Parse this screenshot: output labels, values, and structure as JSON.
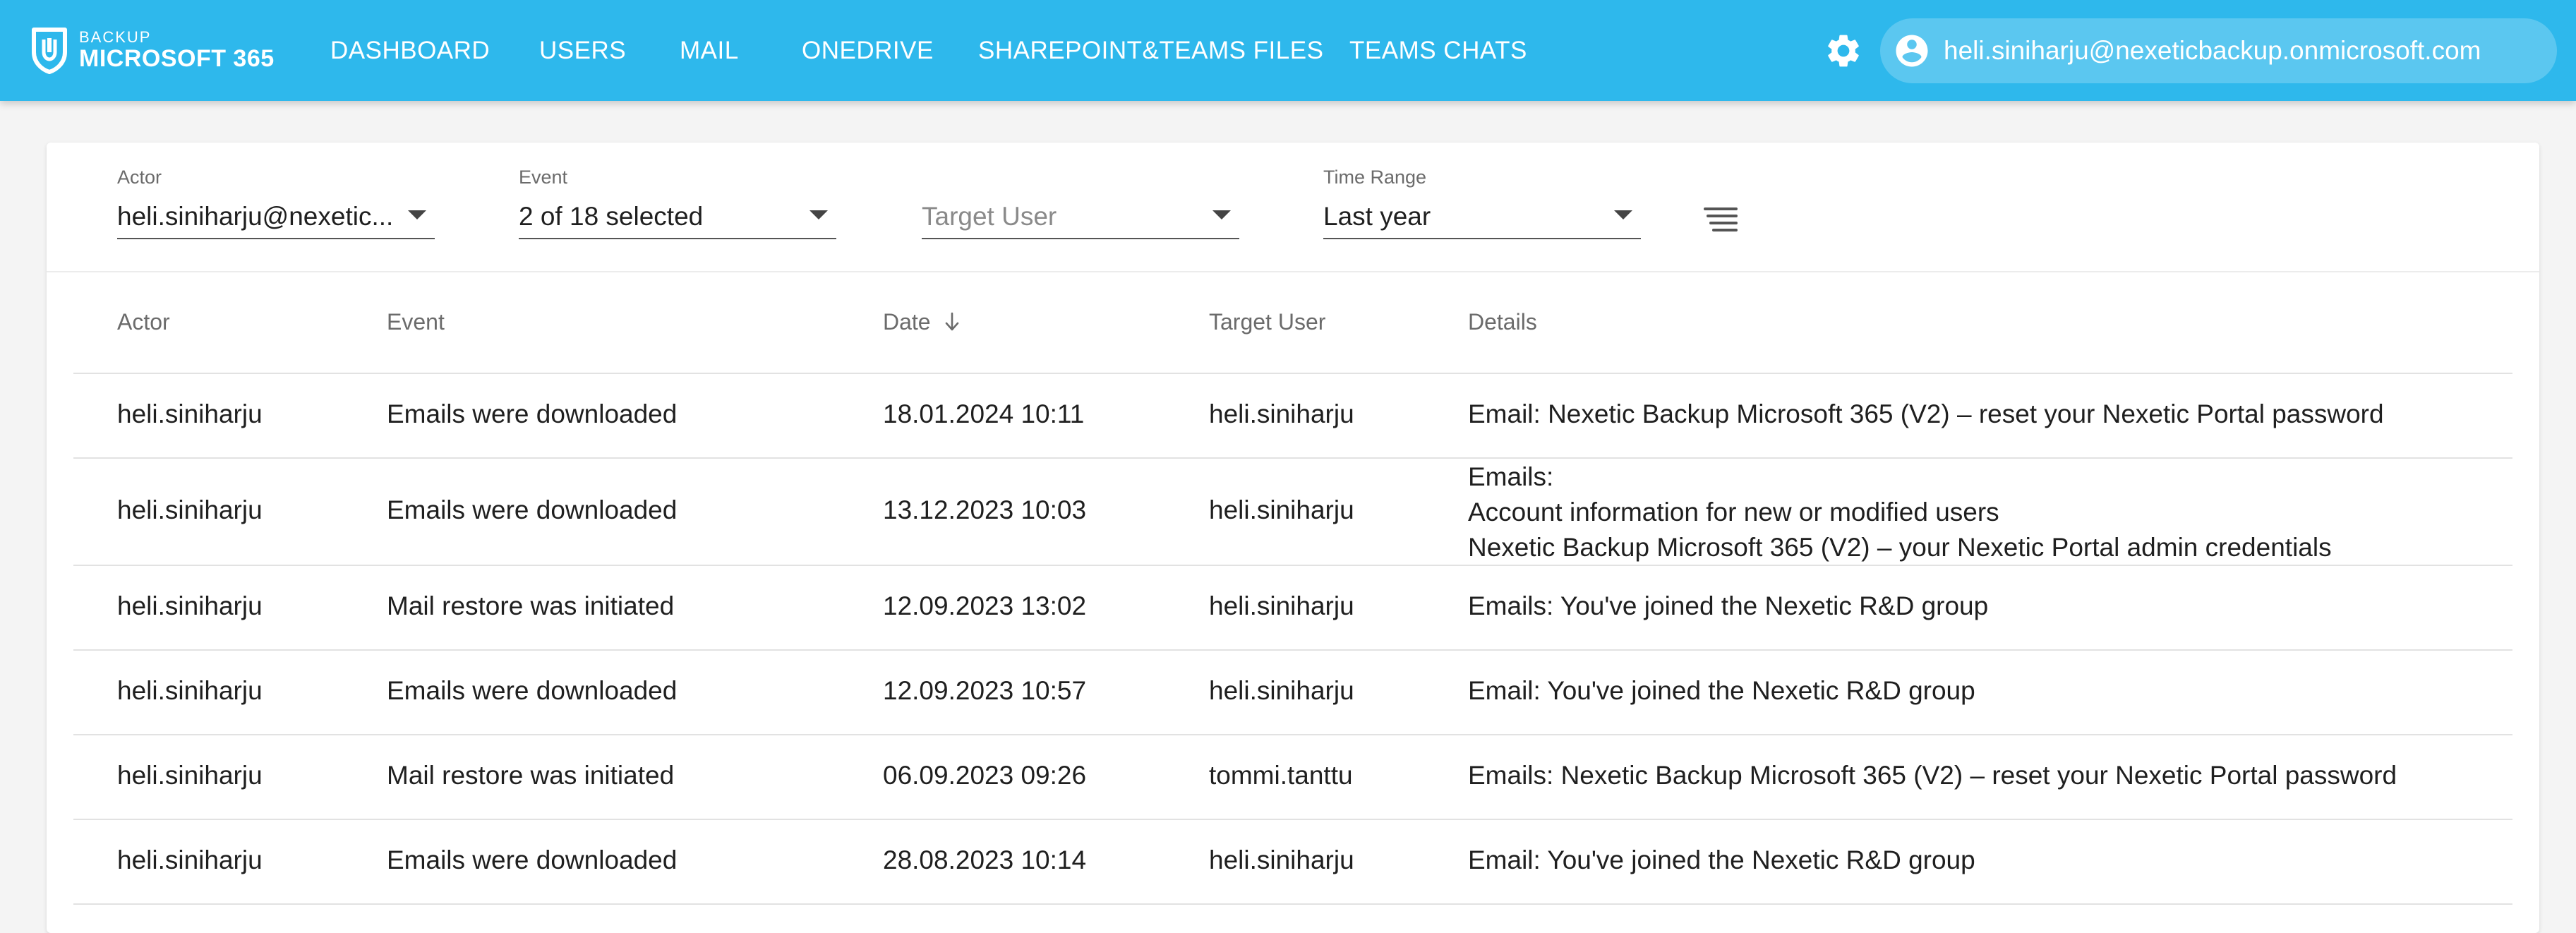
{
  "brand": {
    "small": "BACKUP",
    "main": "MICROSOFT 365"
  },
  "nav": [
    {
      "label": "DASHBOARD"
    },
    {
      "label": "USERS"
    },
    {
      "label": "MAIL"
    },
    {
      "label": "ONEDRIVE"
    },
    {
      "label": "SHAREPOINT&TEAMS FILES"
    },
    {
      "label": "TEAMS CHATS"
    }
  ],
  "user": {
    "email": "heli.siniharju@nexeticbackup.onmicrosoft.com"
  },
  "filters": {
    "actor": {
      "label": "Actor",
      "value": "heli.siniharju@nexetic..."
    },
    "event": {
      "label": "Event",
      "value": "2 of 18 selected"
    },
    "target_user": {
      "placeholder": "Target User"
    },
    "time_range": {
      "label": "Time Range",
      "value": "Last year"
    }
  },
  "table": {
    "headers": {
      "actor": "Actor",
      "event": "Event",
      "date": "Date",
      "target_user": "Target User",
      "details": "Details"
    },
    "rows": [
      {
        "actor": "heli.siniharju",
        "event": "Emails were downloaded",
        "date": "18.01.2024 10:11",
        "target_user": "heli.siniharju",
        "details": [
          "Email: Nexetic Backup Microsoft 365 (V2) – reset your Nexetic Portal password"
        ]
      },
      {
        "actor": "heli.siniharju",
        "event": "Emails were downloaded",
        "date": "13.12.2023 10:03",
        "target_user": "heli.siniharju",
        "details": [
          "Emails:",
          "Account information for new or modified users",
          "Nexetic Backup Microsoft 365 (V2) – your Nexetic Portal admin credentials"
        ]
      },
      {
        "actor": "heli.siniharju",
        "event": "Mail restore was initiated",
        "date": "12.09.2023 13:02",
        "target_user": "heli.siniharju",
        "details": [
          "Emails: You've joined the Nexetic R&D group"
        ]
      },
      {
        "actor": "heli.siniharju",
        "event": "Emails were downloaded",
        "date": "12.09.2023 10:57",
        "target_user": "heli.siniharju",
        "details": [
          "Email: You've joined the Nexetic R&D group"
        ]
      },
      {
        "actor": "heli.siniharju",
        "event": "Mail restore was initiated",
        "date": "06.09.2023 09:26",
        "target_user": "tommi.tanttu",
        "details": [
          "Emails: Nexetic Backup Microsoft 365 (V2) – reset your Nexetic Portal password"
        ]
      },
      {
        "actor": "heli.siniharju",
        "event": "Emails were downloaded",
        "date": "28.08.2023 10:14",
        "target_user": "heli.siniharju",
        "details": [
          "Email: You've joined the Nexetic R&D group"
        ]
      }
    ]
  },
  "colors": {
    "topbar": "#2eb8ec",
    "card": "#ffffff",
    "background": "#f4f4f4"
  },
  "icons": {
    "logo": "shield-logo-icon",
    "settings": "gear-icon",
    "account": "account-circle-icon",
    "dropdown": "caret-down-icon",
    "sort": "arrow-down-icon",
    "filter_toggle": "filter-lines-icon"
  }
}
